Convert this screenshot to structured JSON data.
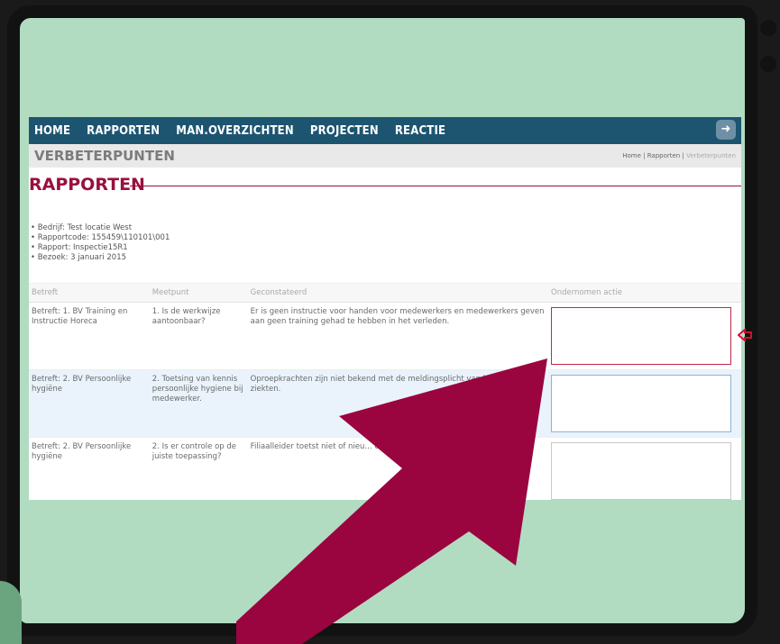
{
  "nav": {
    "items": [
      "HOME",
      "RAPPORTEN",
      "MAN.OVERZICHTEN",
      "PROJECTEN",
      "REACTIE"
    ],
    "logout_icon": "logout-icon"
  },
  "subbar": {
    "title": "VERBETERPUNTEN",
    "breadcrumb": [
      "Home",
      "|",
      "Rapporten",
      "|",
      "Verbeterpunten"
    ]
  },
  "page": {
    "heading": "RAPPORTEN",
    "info": [
      "• Bedrijf: Test locatie West",
      "• Rapportcode: 155459\\110101\\001",
      "• Rapport: Inspectie15R1",
      "• Bezoek: 3 januari 2015"
    ]
  },
  "table": {
    "headers": [
      "Betreft",
      "Meetpunt",
      "Geconstateerd",
      "Ondernomen actie"
    ],
    "rows": [
      {
        "betreft": "Betreft: 1. BV Training en Instructie Horeca",
        "meetpunt": "1. Is de werkwijze aantoonbaar?",
        "geconstateerd": "Er is geen instructie voor handen voor medewerkers en medewerkers geven aan geen training gehad te hebben in het verleden.",
        "actie": ""
      },
      {
        "betreft": "Betreft: 2. BV Persoonlijke hygiëne",
        "meetpunt": "2. Toetsing van kennis persoonlijke hygiene bij medewerker.",
        "geconstateerd": "Oproepkrachten zijn niet bekend met de meldingsplicht van besmettelijke ziekten.",
        "actie": ""
      },
      {
        "betreft": "Betreft: 2. BV Persoonlijke hygiëne",
        "meetpunt": "2. Is er controle op de juiste toepassing?",
        "geconstateerd": "Filiaalleider toetst niet of nieu... en van de basishygiene en voorzie...",
        "actie": ""
      }
    ]
  },
  "colors": {
    "accent": "#9a0f3f",
    "nav_bg": "#1d5571",
    "frame_bg": "#b2dcc2"
  }
}
